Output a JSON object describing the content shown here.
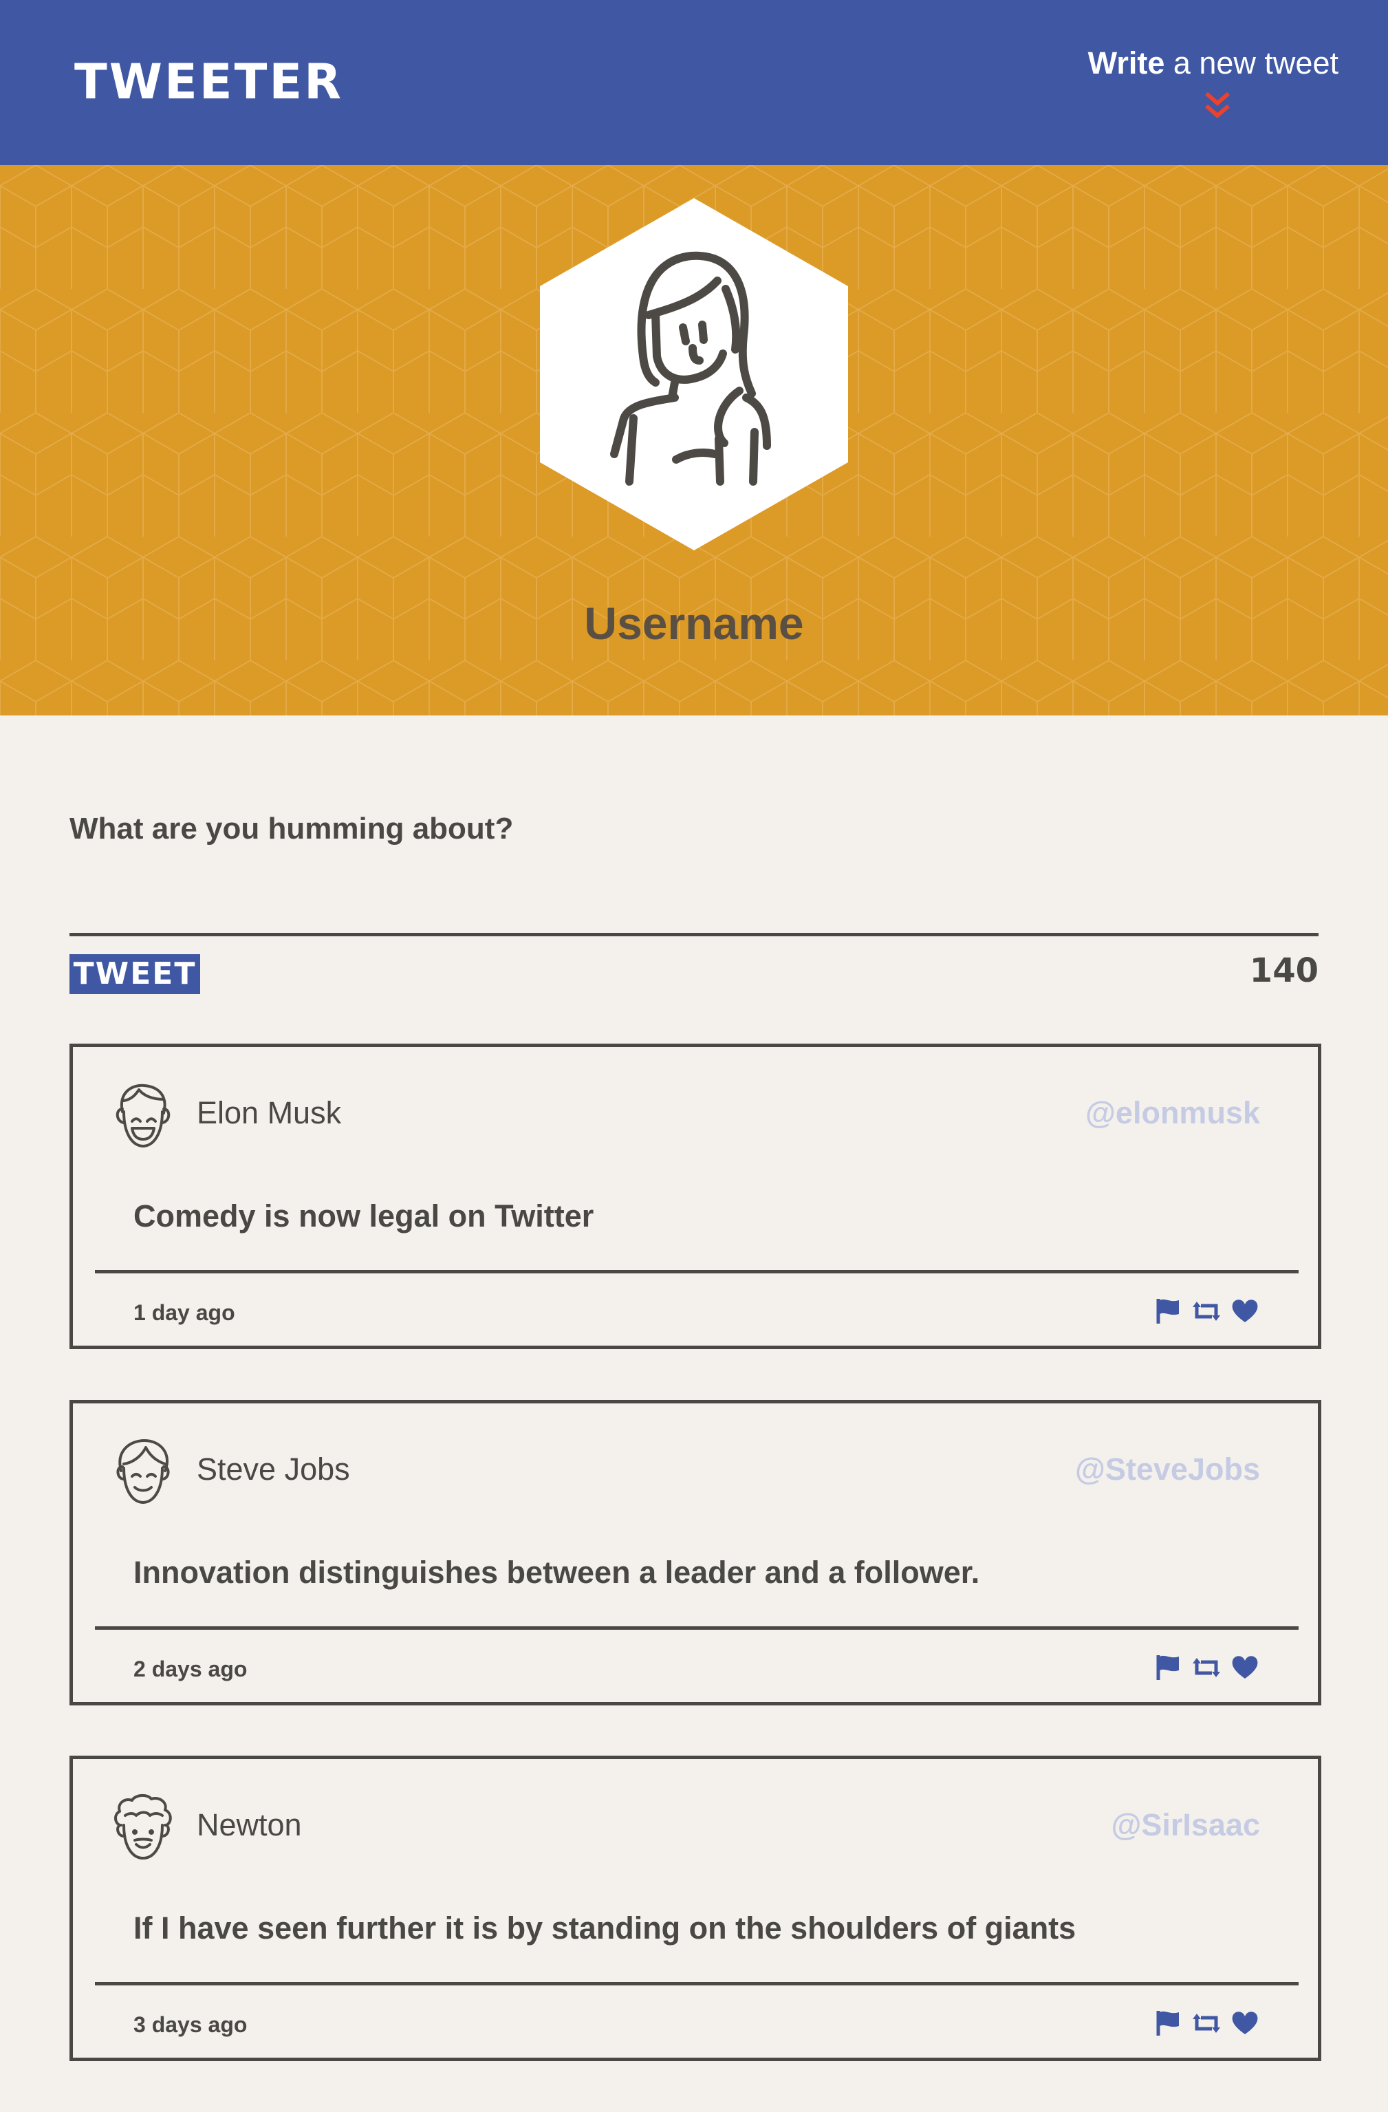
{
  "header": {
    "brand": "TWEETER",
    "write_strong": "Write",
    "write_rest": " a new tweet",
    "accent_color": "#4057a3",
    "chevron_color": "#e8432e"
  },
  "profile": {
    "username": "Username",
    "banner_color": "#dc9a26"
  },
  "composer": {
    "prompt": "What are you humming about?",
    "button_label": "TWEET",
    "char_count": "140"
  },
  "tweets": [
    {
      "name": "Elon Musk",
      "handle": "@elonmusk",
      "text": "Comedy is now legal on Twitter",
      "time": "1 day ago",
      "avatar_icon": "smiling-man-avatar-icon"
    },
    {
      "name": "Steve Jobs",
      "handle": "@SteveJobs",
      "text": "Innovation distinguishes between a leader and a follower.",
      "time": "2 days ago",
      "avatar_icon": "man-avatar-icon"
    },
    {
      "name": "Newton",
      "handle": "@SirIsaac",
      "text": "If I have seen further it is by standing on the shoulders of giants",
      "time": "3 days ago",
      "avatar_icon": "curly-hair-man-avatar-icon"
    }
  ],
  "icons": {
    "flag": "flag-icon",
    "retweet": "retweet-icon",
    "like": "heart-icon"
  }
}
